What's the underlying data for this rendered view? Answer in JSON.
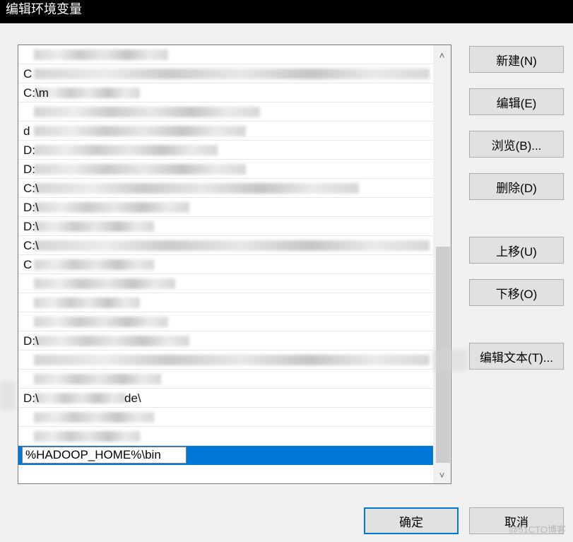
{
  "window": {
    "title": "编辑环境变量"
  },
  "path_list": {
    "items": [
      {
        "prefix": "",
        "blur": 190
      },
      {
        "prefix": "C",
        "blur": 560
      },
      {
        "prefix": "C:\\m",
        "blur": 150
      },
      {
        "prefix": "",
        "blur": 320
      },
      {
        "prefix": "d",
        "blur": 300
      },
      {
        "prefix": "D:",
        "blur": 260
      },
      {
        "prefix": "D:",
        "blur": 300
      },
      {
        "prefix": "C:\\",
        "blur": 460
      },
      {
        "prefix": "D:\\",
        "blur": 220
      },
      {
        "prefix": "D:\\",
        "blur": 170
      },
      {
        "prefix": "C:\\",
        "blur": 560
      },
      {
        "prefix": "C",
        "blur": 170
      },
      {
        "prefix": "",
        "blur": 200
      },
      {
        "prefix": "",
        "blur": 150
      },
      {
        "prefix": "",
        "blur": 190
      },
      {
        "prefix": "D:\\",
        "blur": 220
      },
      {
        "prefix": "",
        "blur": 560
      },
      {
        "prefix": "",
        "blur": 180
      },
      {
        "prefix": "D:\\",
        "suffix": "de\\",
        "blur": 130
      },
      {
        "prefix": "",
        "blur": 170
      },
      {
        "prefix": "",
        "blur": 150
      }
    ],
    "selected_value": "%HADOOP_HOME%\\bin",
    "colors": {
      "selection": "#0078d7"
    }
  },
  "buttons": {
    "new": "新建(N)",
    "edit": "编辑(E)",
    "browse": "浏览(B)...",
    "delete": "删除(D)",
    "move_up": "上移(U)",
    "move_down": "下移(O)",
    "edit_text": "编辑文本(T)...",
    "ok": "确定",
    "cancel": "取消"
  },
  "scrollbar": {
    "up_icon": "chevron-up-icon",
    "down_icon": "chevron-down-icon"
  },
  "watermark": "@51CTO博客"
}
